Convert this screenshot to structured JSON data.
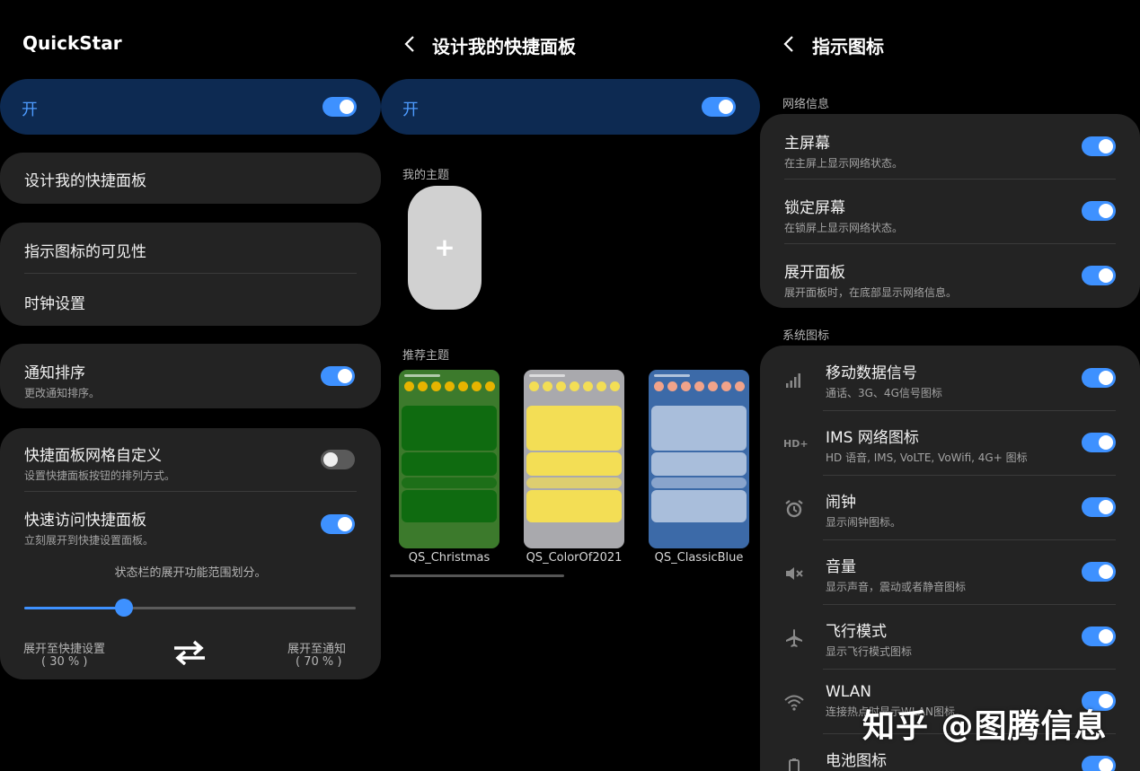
{
  "panel1": {
    "title": "QuickStar",
    "master_label": "开",
    "design_panel": "设计我的快捷面板",
    "icon_visibility": "指示图标的可见性",
    "clock_settings": "时钟设置",
    "notif_sort": {
      "title": "通知排序",
      "sub": "更改通知排序。"
    },
    "grid_custom": {
      "title": "快捷面板网格自定义",
      "sub": "设置快捷面板按钮的排列方式。"
    },
    "quick_access": {
      "title": "快速访问快捷面板",
      "sub": "立刻展开到快捷设置面板。"
    },
    "split_caption": "状态栏的展开功能范围划分。",
    "split_value": 0.3,
    "left_label": "展开至快捷设置",
    "left_pct": "( 30 % )",
    "right_label": "展开至通知",
    "right_pct": "( 70 % )"
  },
  "panel2": {
    "title": "设计我的快捷面板",
    "master_label": "开",
    "my_themes": "我的主题",
    "add_symbol": "+",
    "recommended": "推荐主题",
    "themes": [
      {
        "name": "QS_Christmas",
        "bg": "#3c7a2c",
        "blk": "#0f6b10",
        "icon": "#e6b400"
      },
      {
        "name": "QS_ColorOf2021",
        "bg": "#a9a9ad",
        "blk": "#f3de55",
        "icon": "#f3de55"
      },
      {
        "name": "QS_ClassicBlue",
        "bg": "#3c6aa8",
        "blk": "#a9bedb",
        "icon": "#f1a38a"
      }
    ]
  },
  "panel3": {
    "title": "指示图标",
    "network_section": "网络信息",
    "network_items": [
      {
        "title": "主屏幕",
        "sub": "在主屏上显示网络状态。"
      },
      {
        "title": "锁定屏幕",
        "sub": "在锁屏上显示网络状态。"
      },
      {
        "title": "展开面板",
        "sub": "展开面板时，在底部显示网络信息。"
      }
    ],
    "system_section": "系统图标",
    "system_items": [
      {
        "title": "移动数据信号",
        "sub": "通话、3G、4G信号图标",
        "icon": "signal-icon"
      },
      {
        "title": "IMS 网络图标",
        "sub": "HD 语音, IMS, VoLTE, VoWifi, 4G+ 图标",
        "icon": "hd-plus-icon",
        "icon_text": "HD+"
      },
      {
        "title": "闹钟",
        "sub": "显示闹钟图标。",
        "icon": "alarm-icon"
      },
      {
        "title": "音量",
        "sub": "显示声音，震动或者静音图标",
        "icon": "mute-icon"
      },
      {
        "title": "飞行模式",
        "sub": "显示飞行模式图标",
        "icon": "airplane-icon"
      },
      {
        "title": "WLAN",
        "sub": "连接热点时显示WLAN图标",
        "icon": "wifi-icon"
      },
      {
        "title": "电池图标",
        "sub": "",
        "icon": "battery-icon"
      }
    ]
  },
  "watermark": "知乎 @图腾信息",
  "colors": {
    "accent": "#3e91ff",
    "card": "#232323",
    "master_bg": "#0d2a52"
  }
}
